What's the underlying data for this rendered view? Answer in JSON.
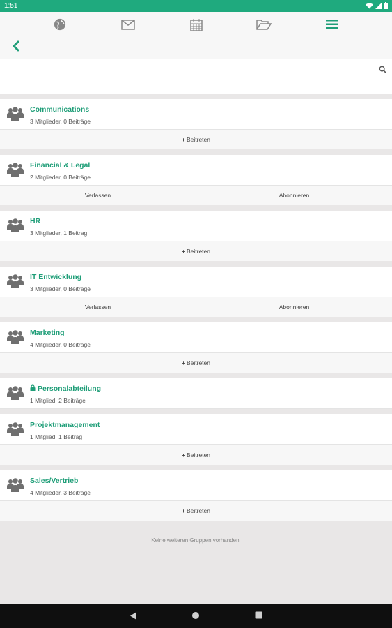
{
  "status": {
    "time": "1:51"
  },
  "nav": {
    "icons": [
      "globe-icon",
      "mail-icon",
      "calendar-icon",
      "folder-icon",
      "menu-icon"
    ],
    "accent": "#1f9e78",
    "brand": "#1faa7e"
  },
  "search": {
    "value": "",
    "placeholder": ""
  },
  "groups": [
    {
      "name": "Communications",
      "meta": "3 Mitglieder, 0 Beiträge",
      "locked": false,
      "actions": [
        "Beitreten"
      ]
    },
    {
      "name": "Financial & Legal",
      "meta": "2 Mitglieder, 0 Beiträge",
      "locked": false,
      "actions": [
        "Verlassen",
        "Abonnieren"
      ]
    },
    {
      "name": "HR",
      "meta": "3 Mitglieder, 1 Beitrag",
      "locked": false,
      "actions": [
        "Beitreten"
      ]
    },
    {
      "name": "IT Entwicklung",
      "meta": "3 Mitglieder, 0 Beiträge",
      "locked": false,
      "actions": [
        "Verlassen",
        "Abonnieren"
      ]
    },
    {
      "name": "Marketing",
      "meta": "4 Mitglieder, 0 Beiträge",
      "locked": false,
      "actions": [
        "Beitreten"
      ]
    },
    {
      "name": "Personalabteilung",
      "meta": "1 Mitglied, 2 Beiträge",
      "locked": true,
      "actions": []
    },
    {
      "name": "Projektmanagement",
      "meta": "1 Mitglied, 1 Beitrag",
      "locked": false,
      "actions": [
        "Beitreten"
      ]
    },
    {
      "name": "Sales/Vertrieb",
      "meta": "4 Mitglieder, 3 Beiträge",
      "locked": false,
      "actions": [
        "Beitreten"
      ]
    }
  ],
  "footer": {
    "note": "Keine weiteren Gruppen vorhanden."
  }
}
